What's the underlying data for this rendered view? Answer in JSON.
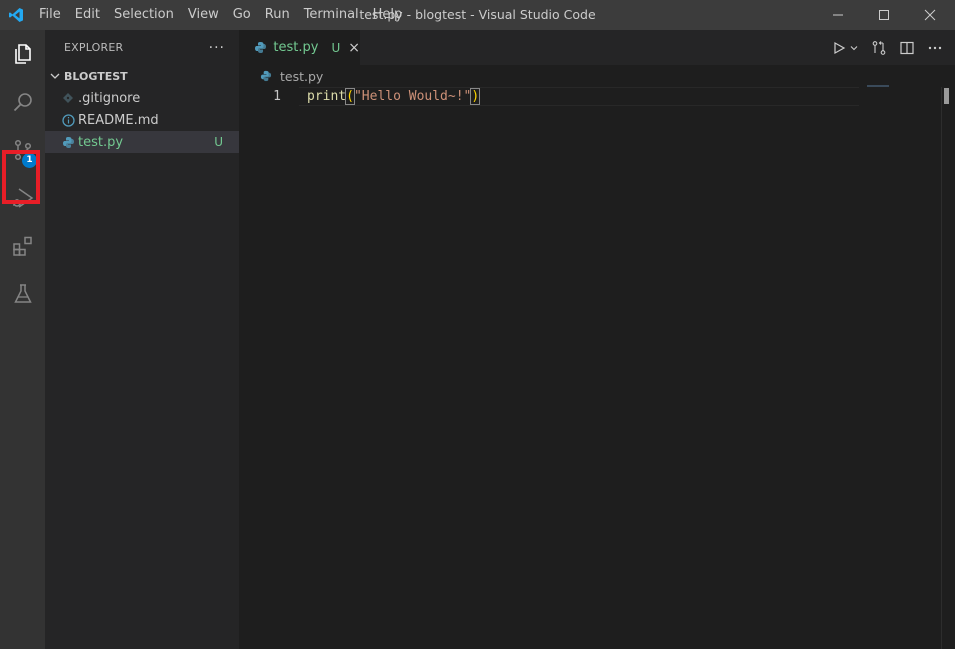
{
  "window": {
    "title": "test.py - blogtest - Visual Studio Code",
    "menu": [
      "File",
      "Edit",
      "Selection",
      "View",
      "Go",
      "Run",
      "Terminal",
      "Help"
    ],
    "controls": {
      "minimize": "minimize-icon",
      "maximize": "maximize-icon",
      "close": "close-icon"
    }
  },
  "activity_bar": {
    "items": [
      {
        "name": "explorer",
        "icon": "files-icon"
      },
      {
        "name": "search",
        "icon": "search-icon"
      },
      {
        "name": "source-control",
        "icon": "source-control-icon",
        "badge": "1",
        "highlighted": true
      },
      {
        "name": "run-debug",
        "icon": "run-debug-icon"
      },
      {
        "name": "extensions",
        "icon": "extensions-icon"
      },
      {
        "name": "testing",
        "icon": "flask-icon"
      }
    ],
    "highlight_color": "#e81e27",
    "badge_color": "#007acc"
  },
  "sidebar": {
    "title": "EXPLORER",
    "more": "···",
    "folder": "BLOGTEST",
    "files": [
      {
        "name": ".gitignore",
        "icon": "git-icon"
      },
      {
        "name": "README.md",
        "icon": "info-icon"
      },
      {
        "name": "test.py",
        "icon": "python-icon",
        "status": "U",
        "active": true
      }
    ]
  },
  "editor": {
    "tab": {
      "label": "test.py",
      "status": "U",
      "close": "×"
    },
    "breadcrumb": "test.py",
    "lines": [
      {
        "number": "1",
        "fn": "print",
        "open": "(",
        "string": "\"Hello Would~!\"",
        "close": ")"
      }
    ],
    "colors": {
      "modified": "#73c991",
      "function": "#dcdcaa",
      "string": "#ce9178",
      "bracket": "#ffd700"
    }
  }
}
